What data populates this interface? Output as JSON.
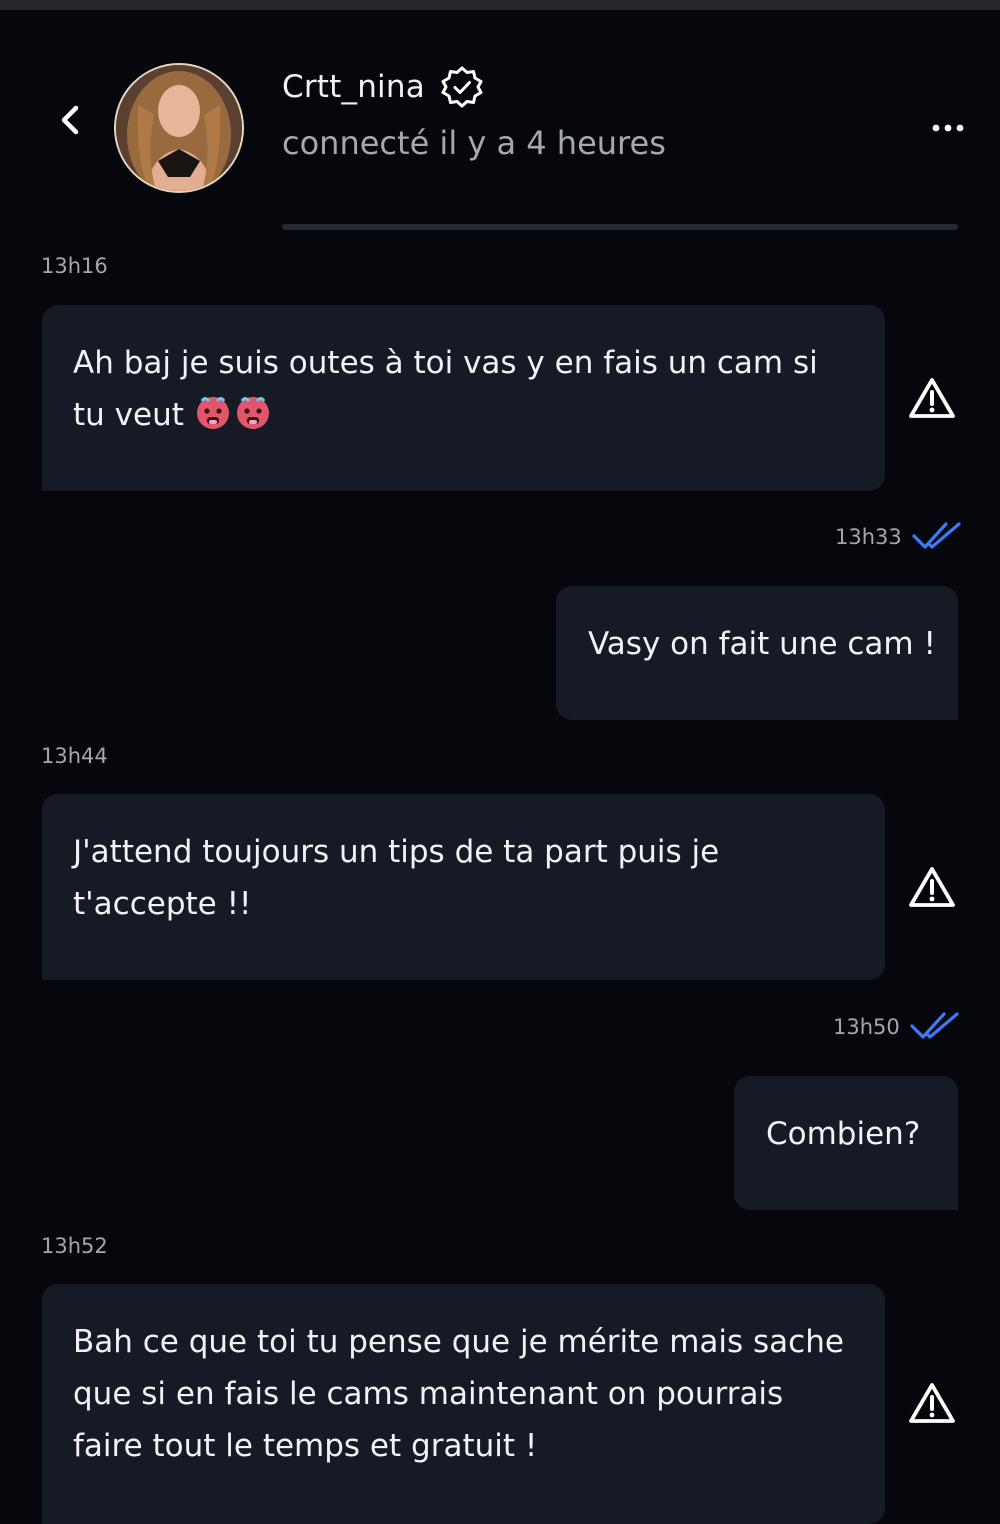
{
  "header": {
    "contact_name": "Crtt_nina",
    "status": "connecté il y a 4 heures",
    "icons": {
      "back": "chevron-left-icon",
      "verified": "verified-badge-icon",
      "more": "more-horizontal-icon"
    }
  },
  "messages": [
    {
      "direction": "incoming",
      "time": "13h16",
      "text": "Ah baj je suis outes à toi vas y en fais un cam si tu veut",
      "emojis": [
        "hot-face-emoji",
        "hot-face-emoji"
      ]
    },
    {
      "direction": "outgoing",
      "time": "13h33",
      "text": "Vasy on fait une cam !",
      "read": true
    },
    {
      "direction": "incoming",
      "time": "13h44",
      "text": "J'attend toujours un tips de ta part puis je t'accepte !!"
    },
    {
      "direction": "outgoing",
      "time": "13h50",
      "text": "Combien?",
      "read": true
    },
    {
      "direction": "incoming",
      "time": "13h52",
      "text": "Bah ce que toi tu pense que je mérite mais sache que si en fais le cams maintenant on pourrais faire tout le temps et gratuit !"
    }
  ],
  "colors": {
    "background": "#05070c",
    "bubble": "#151a24",
    "read_ticks": "#3d7bf5",
    "timestamp": "#a3a7ae"
  }
}
